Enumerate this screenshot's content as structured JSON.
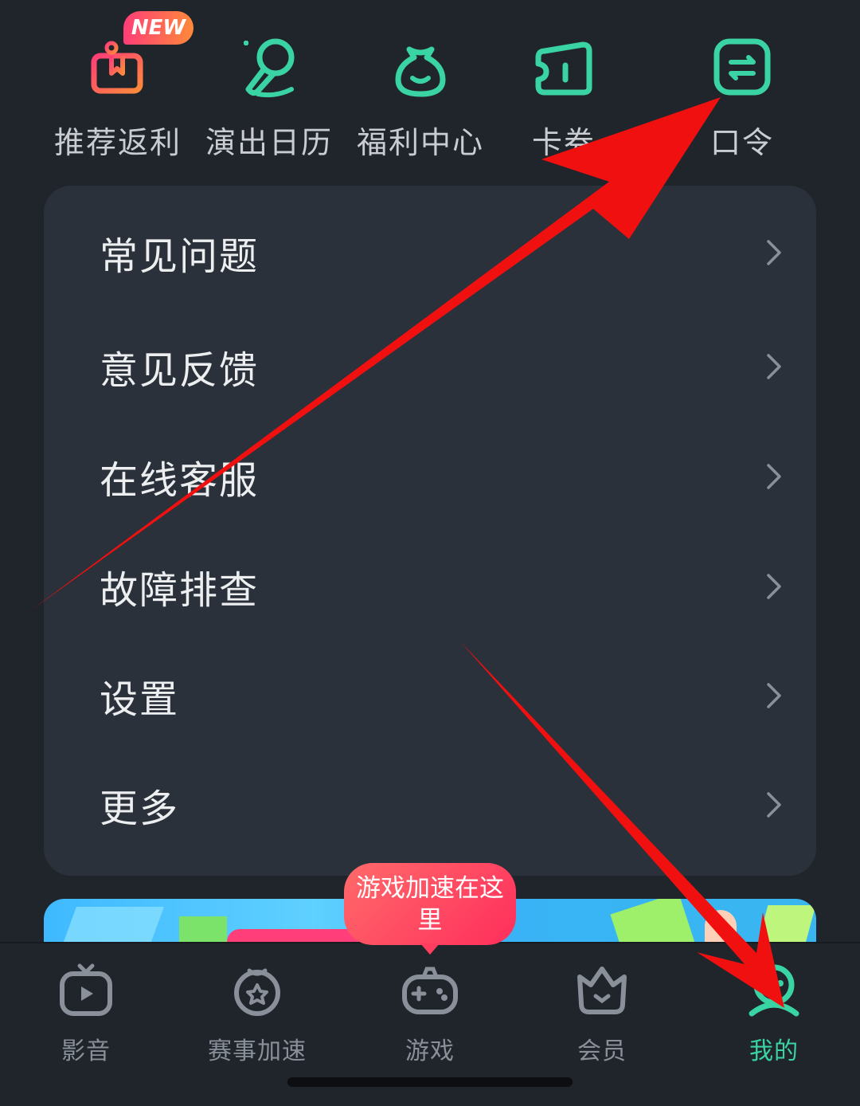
{
  "shortcuts": {
    "items": [
      {
        "label": "推荐返利",
        "icon": "gift-icon"
      },
      {
        "label": "演出日历",
        "icon": "microphone-icon"
      },
      {
        "label": "福利中心",
        "icon": "lucky-bag-icon"
      },
      {
        "label": "卡券",
        "icon": "ticket-icon"
      },
      {
        "label": "口令",
        "icon": "command-icon"
      }
    ],
    "new_badge": "NEW"
  },
  "menu": {
    "items": [
      {
        "label": "常见问题"
      },
      {
        "label": "意见反馈"
      },
      {
        "label": "在线客服"
      },
      {
        "label": "故障排查"
      },
      {
        "label": "设置"
      },
      {
        "label": "更多"
      }
    ]
  },
  "tooltip": {
    "text": "游戏加速在这里"
  },
  "bottom_nav": {
    "tabs": [
      {
        "label": "影音",
        "icon": "video-icon"
      },
      {
        "label": "赛事加速",
        "icon": "event-boost-icon"
      },
      {
        "label": "游戏",
        "icon": "gamepad-icon"
      },
      {
        "label": "会员",
        "icon": "crown-icon"
      },
      {
        "label": "我的",
        "icon": "profile-icon",
        "active": true
      }
    ]
  },
  "colors": {
    "background": "#20252c",
    "card": "#2b313a",
    "accent_green": "#3ad3a3",
    "accent_pink": "#ff3d77",
    "annotation_arrow": "#f01010"
  }
}
